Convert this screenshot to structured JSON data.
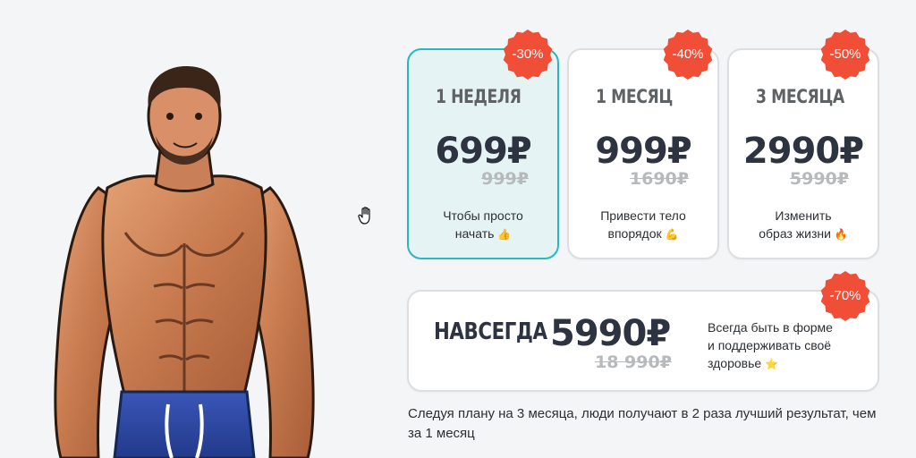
{
  "colors": {
    "accent": "#28b9c0",
    "badge": "#f04e37",
    "text": "#2d3340",
    "muted": "#b7babd",
    "background": "#f3f5f6"
  },
  "illustration": {
    "name": "muscular-man",
    "icon": "man-illustration"
  },
  "plans": [
    {
      "title": "1 НЕДЕЛЯ",
      "price": "699₽",
      "old_price": "999₽",
      "discount": "-30%",
      "desc_line1": "Чтобы просто",
      "desc_line2": "начать",
      "emoji": "👍",
      "selected": true
    },
    {
      "title": "1 МЕСЯЦ",
      "price": "999₽",
      "old_price": "1690₽",
      "discount": "-40%",
      "desc_line1": "Привести тело",
      "desc_line2": "впорядок",
      "emoji": "💪",
      "selected": false
    },
    {
      "title": "3 МЕСЯЦА",
      "price": "2990₽",
      "old_price": "5990₽",
      "discount": "-50%",
      "desc_line1": "Изменить",
      "desc_line2": "образ жизни",
      "emoji": "🔥",
      "selected": false
    }
  ],
  "forever": {
    "title": "НАВСЕГДА",
    "price": "5990₽",
    "old_price": "18 990₽",
    "discount": "-70%",
    "desc_line1": "Всегда быть в форме",
    "desc_line2": "и поддерживать своё",
    "desc_line3": "здоровье",
    "emoji": "⭐"
  },
  "footnote": "Следуя плану на 3 месяца, люди получают в 2 раза лучший результат, чем за 1 месяц"
}
